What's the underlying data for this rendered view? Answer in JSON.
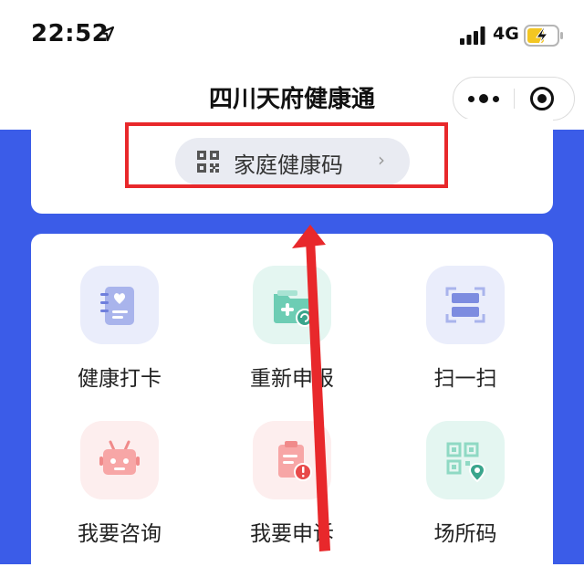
{
  "status_bar": {
    "time": "22:52",
    "network": "4G"
  },
  "nav": {
    "title": "四川天府健康通"
  },
  "family_code": {
    "label": "家庭健康码",
    "chevron": "›"
  },
  "grid": {
    "items": [
      {
        "label": "健康打卡",
        "icon": "health-checkin-icon"
      },
      {
        "label": "重新申报",
        "icon": "re-declare-icon"
      },
      {
        "label": "扫一扫",
        "icon": "scan-icon"
      },
      {
        "label": "我要咨询",
        "icon": "robot-consult-icon"
      },
      {
        "label": "我要申诉",
        "icon": "appeal-icon"
      },
      {
        "label": "场所码",
        "icon": "venue-code-icon"
      }
    ]
  },
  "colors": {
    "accent_blue": "#3b5ce8",
    "highlight_red": "#e8282b"
  }
}
